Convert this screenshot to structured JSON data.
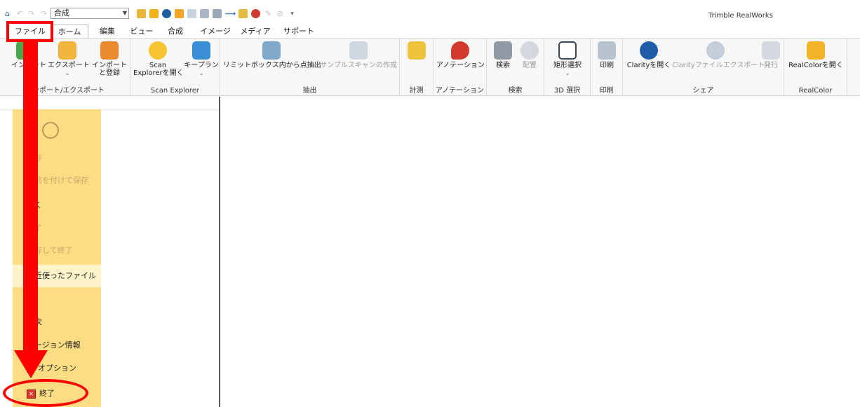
{
  "app": {
    "title": "Trimble RealWorks"
  },
  "quick_access": {
    "combo_value": "合成"
  },
  "tabs": [
    "ファイル",
    "ホーム",
    "編集",
    "ビュー",
    "合成",
    "イメージ",
    "メディア",
    "サポート"
  ],
  "ribbon": {
    "groups": {
      "import_export": "インポート/エクスポート",
      "scan_explorer": "Scan Explorer",
      "extract": "抽出",
      "measure": "計測",
      "annotation": "アノテーション",
      "search": "検索",
      "select3d": "3D 選択",
      "print": "印刷",
      "share": "シェア",
      "realcolor": "RealColor"
    },
    "buttons": {
      "import": "インポート",
      "export": "エクスポート",
      "import_register_1": "インポート",
      "import_register_2": "と登録",
      "scan_explorer_1": "Scan",
      "scan_explorer_2": "Explorerを開く",
      "keyplan": "キープラン",
      "limit_box": "リミットボックス内から点抽出",
      "sample_scan": "サンプルスキャンの作成",
      "annotation": "アノテーション",
      "search": "検索",
      "arrange": "配置",
      "rect_select": "矩形選択",
      "print": "印刷",
      "open_clarity": "Clarityを開く",
      "clarity_export": "Clarityファイルエクスポート",
      "publish": "発行",
      "open_realcolor": "RealColorを開く"
    }
  },
  "backstage": {
    "items": {
      "save": "保存",
      "save_as": "名前を付けて保存",
      "open": "開く",
      "close": "終了",
      "save_close": "保存して終了",
      "recent": "最近使ったファイル",
      "toc": "目次",
      "version": "バージョン情報",
      "options": "オプション",
      "exit": "終了"
    }
  },
  "colors": {
    "highlight": "#ff0000",
    "backstage_bg": "#fcdd84",
    "ribbon_bg": "#f7f7f7"
  }
}
